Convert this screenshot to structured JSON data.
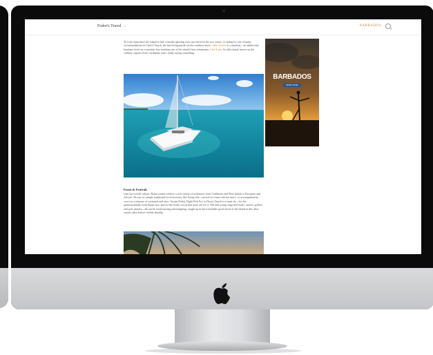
{
  "nav": {
    "brand": "Fodor's Travel",
    "brand_arrow": "→",
    "menu_label": "BARBADOS"
  },
  "article": {
    "para1_a": "To truly experience the island in full, consider splitting your stay between the two coasts, or opting for one of many accommodations in Christ Church, the fun-loving parish on the southern shore. ",
    "para1_link1": "Little Arches",
    "para1_b": " is a standout—an adults-only boutique hotel on a romantic bay boasting one of the island's best restaurants, ",
    "para1_link2": "Café Luna",
    "para1_c": ". Go this island, known as the culinary capital of the Caribbean, that's really saying something.",
    "section_title": "Feasts & Festivals",
    "para2": "Like the overall culture, Bajan cuisine reflects a rich variety of influences from Caribbean and West Indian to European and African. Be sure to sample traditional local favorites, like flying fish—served on a bun with hot sauce, or accompanied by cou-cou, a mixture of cornmeal and okra. Oistins Friday Night Fish Fry in Christ Church is a must-do—for the quintessentially fresh Bajan fare, and for the lively crowd that turns out for it. Old and young cling and locals, surfers, golfers, and polo players—all can be found mixing and mingling, caught up in the irresistible good mood of the island in this ultra-casual, ultra-festive weekly shindig."
  },
  "ad": {
    "title": "BARBADOS",
    "button": "BOOK NOW"
  }
}
